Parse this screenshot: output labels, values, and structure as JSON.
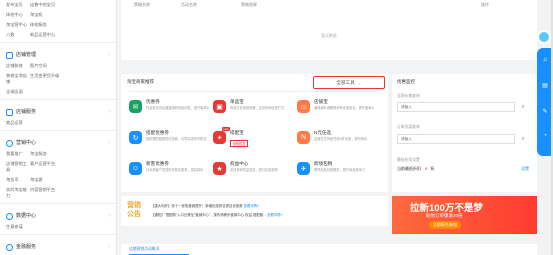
{
  "sidebar": {
    "top_links": [
      "发布宝贝",
      "出售中的宝贝",
      "体检中心",
      "淘宝机",
      "淘宝营中心",
      "体检服务",
      "八数",
      "新品运营中心"
    ],
    "sections": [
      {
        "title": "店铺管理",
        "links": [
          "店铺装修",
          "图片空间",
          "装修宝淘店铺",
          "生活变更货升级",
          "全球店面"
        ]
      },
      {
        "title": "店铺服务",
        "links": [
          "商品运营"
        ]
      },
      {
        "title": "营销中心",
        "links": [
          "我要推广",
          "淘宝服务",
          "店铺营销工具",
          "客户运营平台",
          "淘金币",
          "淘宝客",
          "实时淘宝能力",
          "内容营销平台"
        ]
      },
      {
        "title": "数据中心",
        "links": [
          "生意参谋"
        ]
      },
      {
        "title": "金融服务",
        "links": []
      }
    ]
  },
  "top_table": {
    "headers": [
      "策略名称",
      "活动名称",
      "策略效果",
      "操作"
    ],
    "empty_text": "暂无数据"
  },
  "tools": {
    "title": "淘宝商家推荐",
    "all_tools_label": "全部工具",
    "items": [
      {
        "name": "优惠券",
        "desc": "代金券支持店铺通用和商品优惠，提升客单价",
        "color": "#1aa260",
        "icon": "coupon-icon"
      },
      {
        "name": "单品宝",
        "desc": "商品打折促销利器，支持多种优惠方式",
        "color": "#e53935",
        "icon": "tag-icon"
      },
      {
        "name": "店铺宝",
        "desc": "满减满折满赠等多种优惠组合，提升客单价",
        "color": "#ff7a45",
        "icon": "shop-icon"
      },
      {
        "name": "搭配优惠券",
        "desc": "提供搭配套餐的优惠券，引导买家多件购买",
        "color": "#1890ff",
        "icon": "coupon-icon"
      },
      {
        "name": "搭配宝",
        "desc": "商品搭配套餐工具",
        "color": "#e53935",
        "icon": "gift-icon",
        "tag": "Hot",
        "hot_box": "全网首发"
      },
      {
        "name": "N元任选",
        "desc": "店铺任意商品任选N件优惠，提升转化",
        "color": "#ff7a45",
        "icon": "n-icon"
      },
      {
        "name": "新客优惠券",
        "desc": "针对新客户发放的专属优惠券，提高转化",
        "color": "#1890ff",
        "icon": "user-icon"
      },
      {
        "name": "权益中心",
        "desc": "支持多种权益发放，提升买家复购",
        "color": "#e53935",
        "icon": "star-icon"
      },
      {
        "name": "跨境包税",
        "desc": "跨境商品包税服务，提升商品竞争力",
        "color": "#1890ff",
        "icon": "plane-icon"
      }
    ]
  },
  "right_panel": {
    "title": "优惠监控",
    "label_1": "全网价格查询",
    "placeholder_1": "请输入",
    "label_2": "订单优惠查询",
    "placeholder_2": "请输入",
    "label_3": "最低折扣设置",
    "current_label": "当前最低折扣",
    "current_value": "8",
    "unit": "折",
    "setting_label": "设置"
  },
  "news": {
    "logo_line1": "营销",
    "logo_line2": "公告",
    "line1_text": "【重大利好】双十一参售营销提升！新增优惠券全类目优惠券 ",
    "line1_link": "查看详情»",
    "line2_text": "【通知】\"搭配购\"入口迁移至\"营销中心\"，操作请移步营销中心-权益-搭配套... ",
    "line2_link": "查看详情»"
  },
  "banner": {
    "title": "拉新100万不是梦",
    "sub": "助你订单爆发20倍",
    "btn": "立即报名参加"
  },
  "bottom_tab": "店铺营销活动概况"
}
